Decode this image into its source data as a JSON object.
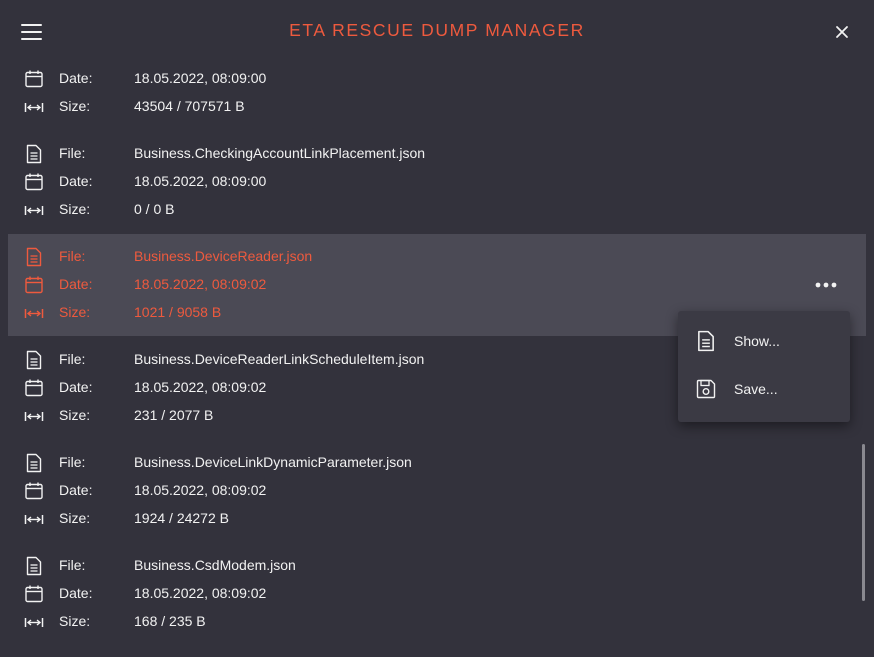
{
  "header": {
    "title": "ETA RESCUE DUMP MANAGER"
  },
  "labels": {
    "file": "File:",
    "date": "Date:",
    "size": "Size:"
  },
  "partial_entry": {
    "date": "18.05.2022, 08:09:00",
    "size": "43504 / 707571 B"
  },
  "entries": [
    {
      "file": "Business.CheckingAccountLinkPlacement.json",
      "date": "18.05.2022, 08:09:00",
      "size": "0 / 0 B"
    },
    {
      "file": "Business.DeviceReader.json",
      "date": "18.05.2022, 08:09:02",
      "size": "1021 / 9058 B"
    },
    {
      "file": "Business.DeviceReaderLinkScheduleItem.json",
      "date": "18.05.2022, 08:09:02",
      "size": "231 / 2077 B"
    },
    {
      "file": "Business.DeviceLinkDynamicParameter.json",
      "date": "18.05.2022, 08:09:02",
      "size": "1924 / 24272 B"
    },
    {
      "file": "Business.CsdModem.json",
      "date": "18.05.2022, 08:09:02",
      "size": "168 / 235 B"
    }
  ],
  "selected_entry": "Business.DeviceReader.json",
  "context_menu": {
    "show_label": "Show...",
    "save_label": "Save..."
  },
  "colors": {
    "accent": "#ee5a3e",
    "background": "#33323c",
    "selected_row": "#4b4a55",
    "text": "#f2f2f2"
  }
}
